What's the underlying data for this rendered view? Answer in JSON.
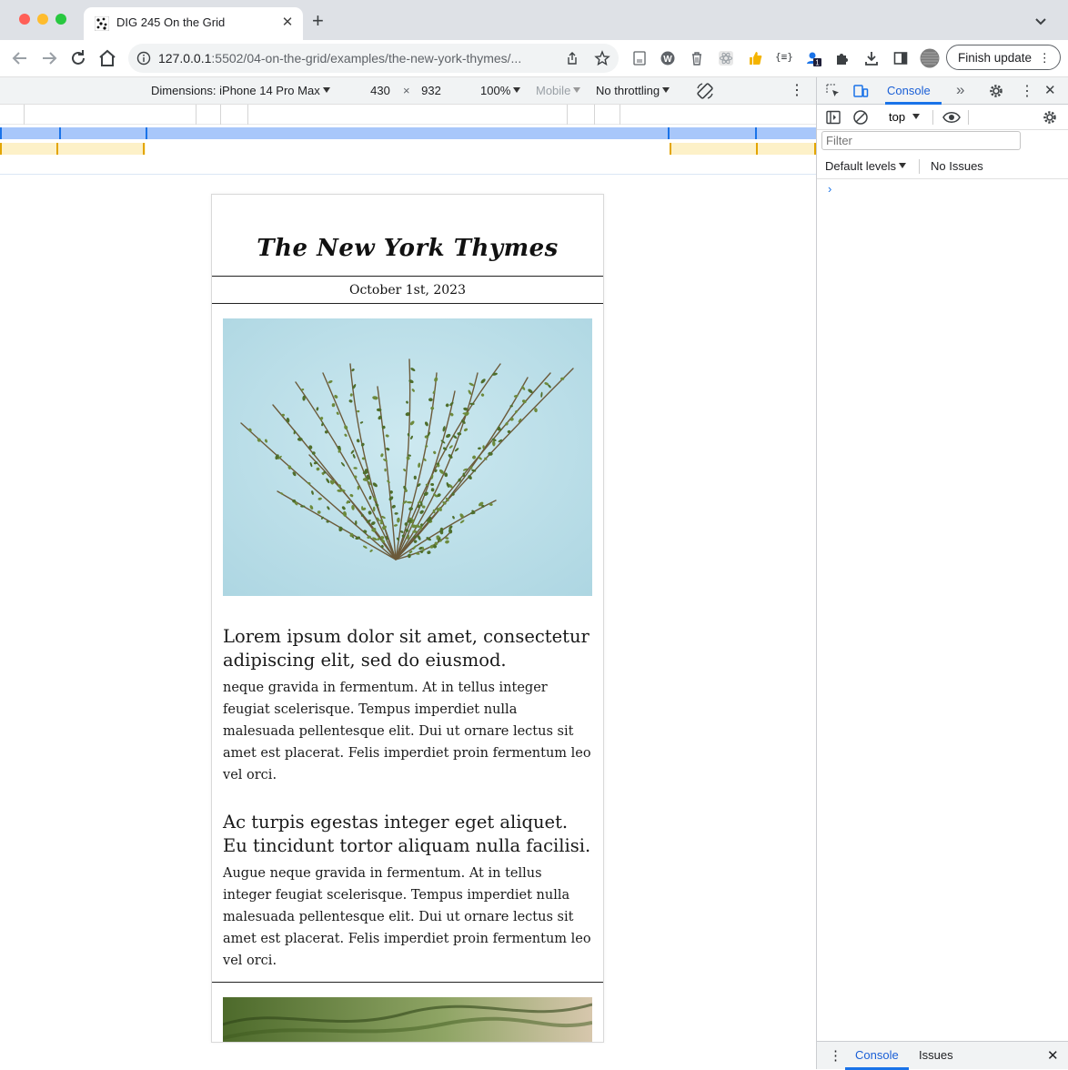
{
  "browser": {
    "tab_title": "DIG 245 On the Grid",
    "url_host": "127.0.0.1",
    "url_rest": ":5502/04-on-the-grid/examples/the-new-york-thymes/...",
    "finish_update_label": "Finish update",
    "extension_badge": "1"
  },
  "device_toolbar": {
    "dimensions_label": "Dimensions: iPhone 14 Pro Max",
    "width": "430",
    "times": "×",
    "height": "932",
    "zoom": "100%",
    "mode": "Mobile",
    "throttling": "No throttling"
  },
  "page": {
    "masthead": "The New York Thymes",
    "date": "October 1st, 2023",
    "articles": [
      {
        "headline": "Lorem ipsum dolor sit amet, consectetur adipiscing elit, sed do eiusmod.",
        "body": "neque gravida in fermentum. At in tellus integer feugiat scelerisque. Tempus imperdiet nulla malesuada pellentesque elit. Dui ut ornare lectus sit amet est placerat. Felis imperdiet proin fermentum leo vel orci."
      },
      {
        "headline": "Ac turpis egestas integer eget aliquet. Eu tincidunt tortor aliquam nulla facilisi.",
        "body": "Augue neque gravida in fermentum. At in tellus integer feugiat scelerisque. Tempus imperdiet nulla malesuada pellentesque elit. Dui ut ornare lectus sit amet est placerat. Felis imperdiet proin fermentum leo vel orci."
      }
    ]
  },
  "devtools": {
    "console_tab": "Console",
    "context": "top",
    "filter_placeholder": "Filter",
    "levels": "Default levels",
    "issues": "No Issues",
    "prompt": "›",
    "drawer_console": "Console",
    "drawer_issues": "Issues"
  },
  "colors": {
    "accent": "#1a73e8",
    "hero_background": "#bfe1ea",
    "herb_green": "#4e6e2c"
  }
}
